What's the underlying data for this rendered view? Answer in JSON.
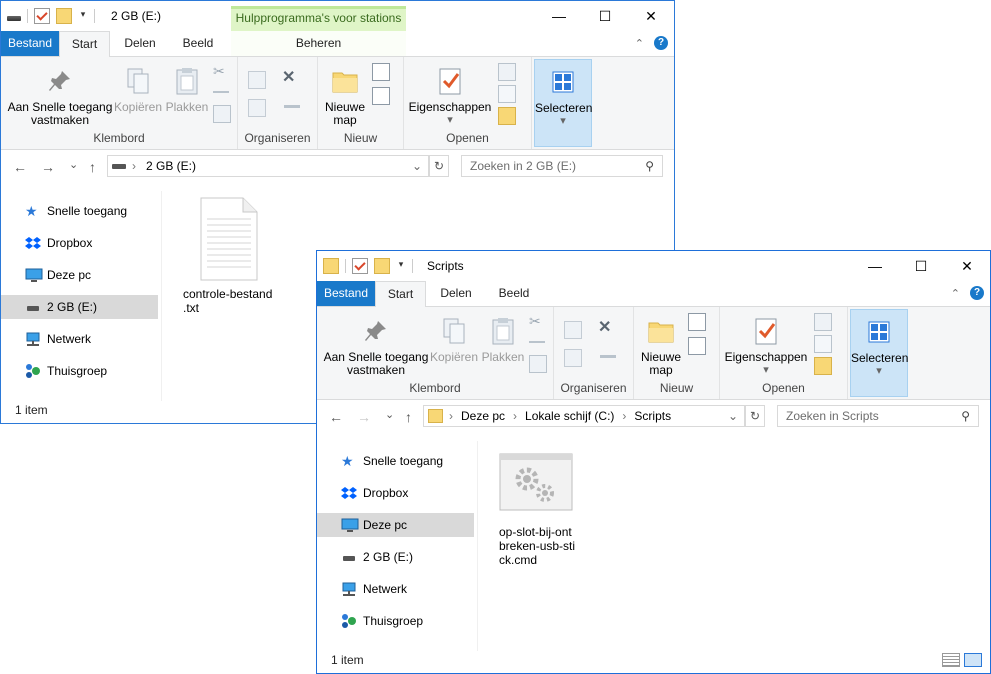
{
  "win1": {
    "qat_caret": "▾",
    "title": "2 GB (E:)",
    "context_tab": "Hulpprogramma's voor stations",
    "tabs": {
      "file": "Bestand",
      "start": "Start",
      "share": "Delen",
      "view": "Beeld",
      "manage": "Beheren"
    },
    "ribbon": {
      "pin_l1": "Aan Snelle toegang",
      "pin_l2": "vastmaken",
      "copy": "Kopiëren",
      "paste": "Plakken",
      "clipboard": "Klembord",
      "organize": "Organiseren",
      "newfolder_l1": "Nieuwe",
      "newfolder_l2": "map",
      "new": "Nieuw",
      "properties": "Eigenschappen",
      "open": "Openen",
      "select": "Selecteren"
    },
    "address": "2 GB (E:)",
    "search_placeholder": "Zoeken in 2 GB (E:)",
    "nav": [
      "Snelle toegang",
      "Dropbox",
      "Deze pc",
      "2 GB (E:)",
      "Netwerk",
      "Thuisgroep"
    ],
    "file_l1": "controle-bestand",
    "file_l2": ".txt",
    "status": "1 item"
  },
  "win2": {
    "qat_caret": "▾",
    "title": "Scripts",
    "tabs": {
      "file": "Bestand",
      "start": "Start",
      "share": "Delen",
      "view": "Beeld"
    },
    "ribbon": {
      "pin_l1": "Aan Snelle toegang",
      "pin_l2": "vastmaken",
      "copy": "Kopiëren",
      "paste": "Plakken",
      "clipboard": "Klembord",
      "organize": "Organiseren",
      "newfolder_l1": "Nieuwe",
      "newfolder_l2": "map",
      "new": "Nieuw",
      "properties": "Eigenschappen",
      "open": "Openen",
      "select": "Selecteren"
    },
    "breadcrumb": [
      "Deze pc",
      "Lokale schijf (C:)",
      "Scripts"
    ],
    "search_placeholder": "Zoeken in Scripts",
    "nav": [
      "Snelle toegang",
      "Dropbox",
      "Deze pc",
      "2 GB (E:)",
      "Netwerk",
      "Thuisgroep"
    ],
    "file_l1": "op-slot-bij-ont",
    "file_l2": "breken-usb-sti",
    "file_l3": "ck.cmd",
    "status": "1 item"
  },
  "glyphs": {
    "minimize": "—",
    "maximize": "☐",
    "close": "✕",
    "back": "←",
    "forward": "→",
    "recent": "⌄",
    "up": "↑",
    "refresh": "↻",
    "search": "⚲",
    "dropdown": "⌄",
    "crumb_sep": "›",
    "ribbon_collapse": "⌃",
    "help": "?",
    "down_caret": "▾",
    "star": "★"
  },
  "colors": {
    "file_tab": "#1979ca",
    "context_tab": "#dff5c7",
    "window_border": "#2b79d8",
    "selected_nav": "#d9d9d9"
  }
}
